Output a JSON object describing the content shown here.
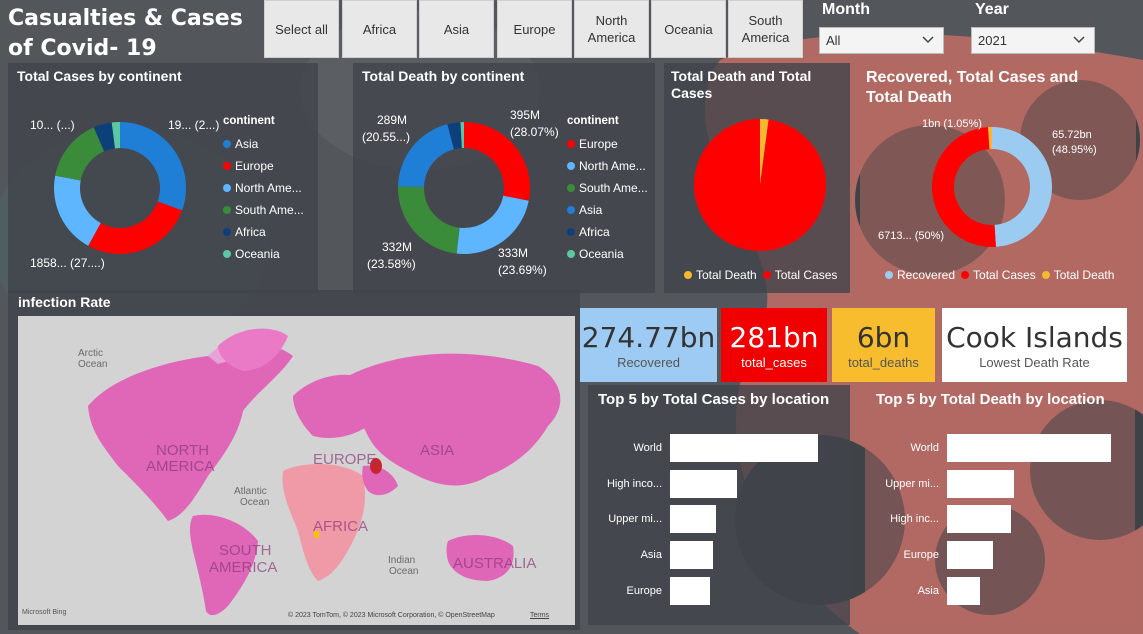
{
  "title": "Casualties & Cases of Covid- 19",
  "slicer": [
    "Select all",
    "Africa",
    "Asia",
    "Europe",
    "North America",
    "Oceania",
    "South America"
  ],
  "month": {
    "label": "Month",
    "value": "All"
  },
  "year": {
    "label": "Year",
    "value": "2021"
  },
  "colors": {
    "asia": "#1f7fd6",
    "europe": "#ff0000",
    "north_america": "#5db6ff",
    "south_america": "#3a8c3a",
    "africa": "#0d3f7a",
    "oceania": "#5bc8a1",
    "total_death": "#f5b82e",
    "recovered": "#9ccbf2"
  },
  "total_cases_chart": {
    "title": "Total Cases by continent",
    "legend_title": "continent",
    "legend": [
      "Asia",
      "Europe",
      "North Ame...",
      "South Ame...",
      "Africa",
      "Oceania"
    ],
    "labels": [
      "19... (2...)",
      "1858... (27....)",
      "10... (...)"
    ]
  },
  "total_death_chart": {
    "title": "Total Death by continent",
    "legend_title": "continent",
    "legend": [
      "Europe",
      "North Ame...",
      "South Ame...",
      "Asia",
      "Africa",
      "Oceania"
    ],
    "labels": [
      "395M",
      "(28.07%)",
      "333M",
      "(23.69%)",
      "332M",
      "(23.58%)",
      "289M",
      "(20.55...)"
    ]
  },
  "death_cases_pie": {
    "title": "Total Death and Total Cases",
    "legend": [
      "Total Death",
      "Total Cases"
    ]
  },
  "recovered_chart": {
    "title": "Recovered, Total Cases and Total Death",
    "legend": [
      "Recovered",
      "Total Cases",
      "Total Death"
    ],
    "labels": [
      "1bn (1.05%)",
      "65.72bn",
      "(48.95%)",
      "6713... (50%)"
    ]
  },
  "chart_data": [
    {
      "type": "pie",
      "title": "Total Cases by continent",
      "categories": [
        "Asia",
        "Europe",
        "North America",
        "South America",
        "Africa",
        "Oceania"
      ],
      "values": [
        30.5,
        27.5,
        20.0,
        15.5,
        4.5,
        2.0
      ]
    },
    {
      "type": "pie",
      "title": "Total Death by continent",
      "categories": [
        "Europe",
        "North America",
        "South America",
        "Asia",
        "Africa",
        "Oceania"
      ],
      "values": [
        395,
        333,
        332,
        289,
        45,
        12
      ]
    },
    {
      "type": "pie",
      "title": "Total Death and Total Cases",
      "categories": [
        "Total Death",
        "Total Cases"
      ],
      "values": [
        6,
        281
      ]
    },
    {
      "type": "pie",
      "title": "Recovered, Total Cases and Total Death",
      "categories": [
        "Recovered",
        "Total Cases",
        "Total Death"
      ],
      "values": [
        48.95,
        50.0,
        1.05
      ]
    },
    {
      "type": "bar",
      "title": "Top 5 by Total Cases by location",
      "categories": [
        "World",
        "High inco...",
        "Upper mi...",
        "Asia",
        "Europe"
      ],
      "values": [
        100,
        45,
        31,
        29,
        27
      ]
    },
    {
      "type": "bar",
      "title": "Top 5 by Total Death by location",
      "categories": [
        "World",
        "Upper mi...",
        "High inc...",
        "Europe",
        "Asia"
      ],
      "values": [
        100,
        41,
        39,
        28,
        20
      ]
    }
  ],
  "infection_map": {
    "title": "infection Rate",
    "labels": [
      "Arctic",
      "Ocean",
      "NORTH",
      "AMERICA",
      "EUROPE",
      "ASIA",
      "Atlantic",
      "Ocean",
      "AFRICA",
      "SOUTH",
      "AMERICA",
      "Indian",
      "Ocean",
      "AUSTRALIA"
    ],
    "attribution": "© 2023 TomTom, © 2023 Microsoft Corporation, © OpenStreetMap",
    "terms": "Terms",
    "brand": "Microsoft Bing"
  },
  "cards": [
    {
      "value": "274.77bn",
      "label": "Recovered"
    },
    {
      "value": "281bn",
      "label": "total_cases"
    },
    {
      "value": "6bn",
      "label": "total_deaths"
    },
    {
      "value": "Cook Islands",
      "label": "Lowest Death Rate"
    }
  ],
  "top_cases": {
    "title": "Top 5 by Total Cases by location",
    "labels": [
      "World",
      "High inco...",
      "Upper mi...",
      "Asia",
      "Europe"
    ]
  },
  "top_death": {
    "title": "Top 5 by Total Death by location",
    "labels": [
      "World",
      "Upper mi...",
      "High inc...",
      "Europe",
      "Asia"
    ]
  }
}
